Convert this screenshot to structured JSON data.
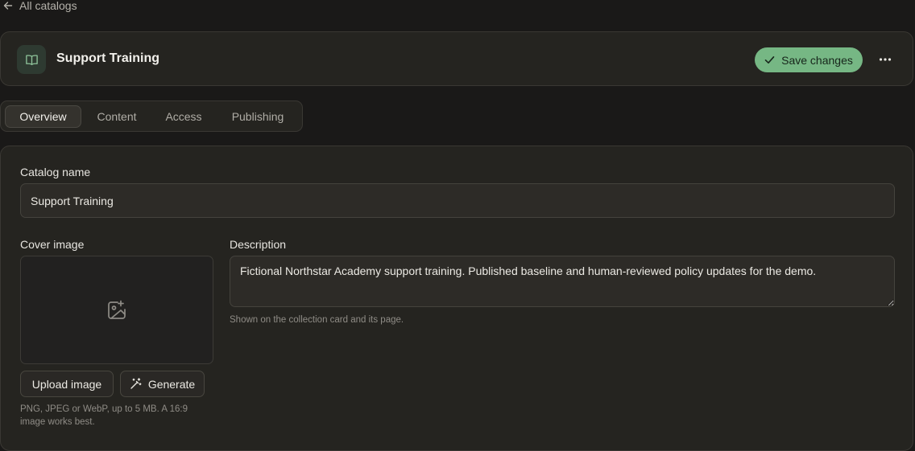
{
  "nav": {
    "back_label": "All catalogs"
  },
  "header": {
    "title": "Support Training",
    "save_label": "Save changes",
    "icon": "book-open-icon",
    "more_icon": "more-horizontal-icon"
  },
  "tabs": [
    {
      "label": "Overview",
      "active": true
    },
    {
      "label": "Content",
      "active": false
    },
    {
      "label": "Access",
      "active": false
    },
    {
      "label": "Publishing",
      "active": false
    }
  ],
  "form": {
    "name_label": "Catalog name",
    "name_value": "Support Training",
    "cover_label": "Cover image",
    "cover_icon": "image-plus-icon",
    "upload_label": "Upload image",
    "generate_label": "Generate",
    "cover_help_line1": "PNG, JPEG or WebP, up to 5 MB. A 16:9",
    "cover_help_line2": "image works best.",
    "description_label": "Description",
    "description_value": "Fictional Northstar Academy support training. Published baseline and human-reviewed policy updates for the demo.",
    "description_help": "Shown on the collection card and its page."
  },
  "colors": {
    "accent": "#76b784",
    "background": "#1a1918",
    "card": "#252420"
  }
}
